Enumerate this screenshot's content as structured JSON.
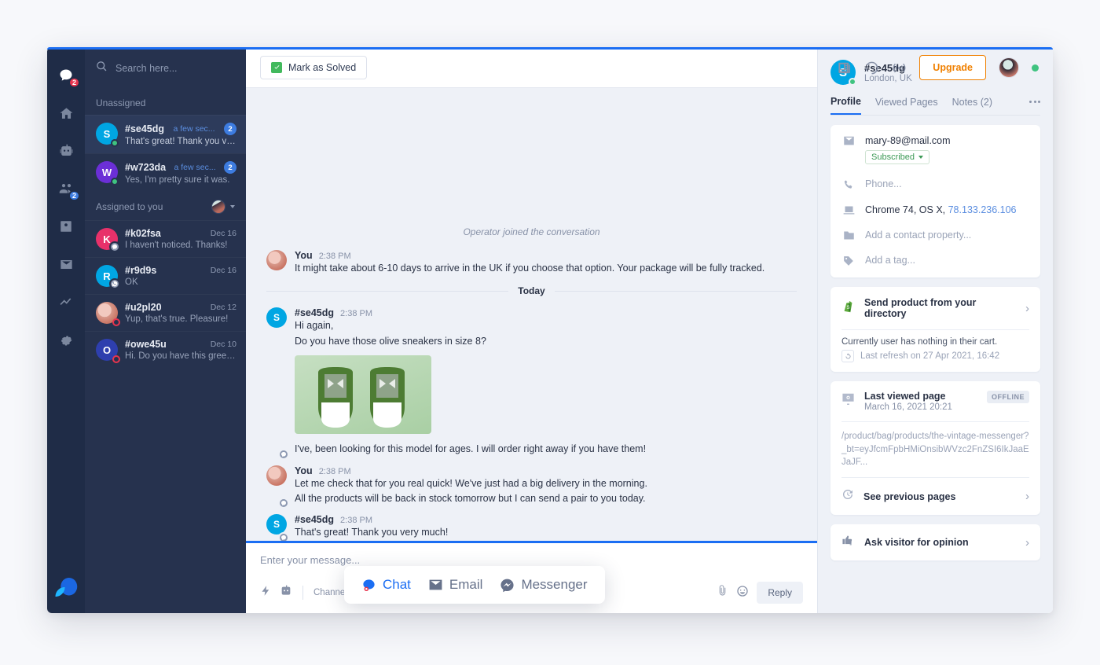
{
  "rail": {
    "items": [
      {
        "name": "chat",
        "icon": "chat-icon",
        "badge": "2",
        "badge_color": "red",
        "active": true
      },
      {
        "name": "home",
        "icon": "home-icon",
        "badge": "",
        "badge_color": "",
        "active": false
      },
      {
        "name": "bot",
        "icon": "robot-icon",
        "badge": "",
        "badge_color": "",
        "active": false
      },
      {
        "name": "visitors",
        "icon": "people-icon",
        "badge": "2",
        "badge_color": "blue",
        "active": false
      },
      {
        "name": "contacts",
        "icon": "contact-card-icon",
        "badge": "",
        "badge_color": "",
        "active": false
      },
      {
        "name": "mail",
        "icon": "envelope-icon",
        "badge": "",
        "badge_color": "",
        "active": false
      },
      {
        "name": "reports",
        "icon": "trend-line-icon",
        "badge": "",
        "badge_color": "",
        "active": false
      },
      {
        "name": "settings",
        "icon": "gear-icon",
        "badge": "",
        "badge_color": "",
        "active": false
      }
    ]
  },
  "search": {
    "placeholder": "Search here...",
    "value": ""
  },
  "conversations": {
    "groups": [
      {
        "title": "Unassigned",
        "has_assignee": false,
        "items": [
          {
            "name": "#se45dg",
            "preview": "That's great! Thank you very much!",
            "time": "a few sec...",
            "time_fresh": true,
            "count": "2",
            "initial": "S",
            "color": "#00a6e3",
            "presence": "online",
            "channel_icon": "",
            "selected": true
          },
          {
            "name": "#w723da",
            "preview": "Yes, I'm pretty sure it was.",
            "time": "a few sec...",
            "time_fresh": true,
            "count": "2",
            "initial": "W",
            "color": "#6b2fd6",
            "presence": "online",
            "channel_icon": "",
            "selected": false
          }
        ]
      },
      {
        "title": "Assigned to you",
        "has_assignee": true,
        "items": [
          {
            "name": "#k02fsa",
            "preview": "I haven't noticed. Thanks!",
            "time": "Dec 16",
            "time_fresh": false,
            "count": "",
            "initial": "K",
            "color": "#e8316a",
            "presence": "none",
            "channel_icon": "messenger",
            "selected": false
          },
          {
            "name": "#r9d9s",
            "preview": "OK",
            "time": "Dec 16",
            "time_fresh": false,
            "count": "",
            "initial": "R",
            "color": "#00a6e3",
            "presence": "none",
            "channel_icon": "whatsapp",
            "selected": false
          },
          {
            "name": "#u2pl20",
            "preview": "Yup, that's true. Pleasure!",
            "time": "Dec 12",
            "time_fresh": false,
            "count": "",
            "initial": "",
            "color": "photo",
            "presence": "none",
            "channel_icon": "ring",
            "selected": false
          },
          {
            "name": "#owe45u",
            "preview": "Hi. Do you have this green t-shirt?",
            "time": "Dec 10",
            "time_fresh": false,
            "count": "",
            "initial": "O",
            "color": "#2e3fae",
            "presence": "none",
            "channel_icon": "ring",
            "selected": false
          }
        ]
      }
    ]
  },
  "header": {
    "solve_label": "Mark as Solved",
    "upgrade_label": "Upgrade",
    "icons": [
      "news-icon",
      "loading-circle-icon",
      "broadcast-icon"
    ]
  },
  "chat": {
    "system_line": "Operator joined the conversation",
    "today_label": "Today",
    "messages": [
      {
        "author": "You",
        "time": "2:38 PM",
        "avatar": "photo",
        "initial": "",
        "color": "photo",
        "channel_icon": "",
        "lines": [
          "It might take about 6-10 days to arrive in the UK if you choose that option. Your package will be fully tracked."
        ],
        "image": false
      },
      {
        "author": "#se45dg",
        "time": "2:38 PM",
        "avatar": "initial",
        "initial": "S",
        "color": "#00a6e3",
        "channel_icon": "messenger",
        "lines": [
          "Hi again,",
          "Do you have those olive sneakers in size 8?"
        ],
        "image": true,
        "after_image": "I've, been looking for this model for ages. I will order right away if you have them!"
      },
      {
        "author": "You",
        "time": "2:38 PM",
        "avatar": "photo",
        "initial": "",
        "color": "photo",
        "channel_icon": "messenger",
        "lines": [
          "Let me check that for you real quick! We've just had a big delivery in the morning.",
          "All the products will be back in stock tomorrow but I can send a pair to you today."
        ],
        "image": false
      },
      {
        "author": "#se45dg",
        "time": "2:38 PM",
        "avatar": "initial",
        "initial": "S",
        "color": "#00a6e3",
        "channel_icon": "messenger",
        "lines": [
          "That's great! Thank you very much!"
        ],
        "image": false
      }
    ]
  },
  "composer": {
    "placeholder": "Enter your message...",
    "channel_label": "Channel:",
    "reply_label": "Reply",
    "channels": [
      {
        "label": "Chat",
        "icon": "chat-bubble-icon",
        "active": true
      },
      {
        "label": "Email",
        "icon": "envelope-icon",
        "active": false
      },
      {
        "label": "Messenger",
        "icon": "messenger-icon",
        "active": false
      }
    ]
  },
  "profile": {
    "name": "#se45dg",
    "location": "London, UK",
    "initial": "S",
    "color": "#00a6e3",
    "tabs": [
      {
        "label": "Profile",
        "active": true
      },
      {
        "label": "Viewed Pages",
        "active": false
      },
      {
        "label": "Notes (2)",
        "active": false
      }
    ],
    "fields": [
      {
        "icon": "envelope-icon",
        "value": "mary-89@mail.com",
        "muted": false,
        "badge": "Subscribed"
      },
      {
        "icon": "phone-icon",
        "value": "Phone...",
        "muted": true,
        "badge": ""
      },
      {
        "icon": "laptop-icon",
        "value": "Chrome 74, OS X,",
        "ip": "78.133.236.106",
        "muted": false,
        "badge": ""
      },
      {
        "icon": "folder-icon",
        "value": "Add a contact property...",
        "muted": true,
        "badge": ""
      },
      {
        "icon": "tag-icon",
        "value": "Add a tag...",
        "muted": true,
        "badge": ""
      }
    ],
    "product_card": {
      "title": "Send product from your directory",
      "icon": "shopify-icon",
      "cart_note": "Currently user has nothing in their cart.",
      "refresh_text": "Last refresh on 27 Apr 2021, 16:42"
    },
    "last_page_card": {
      "title": "Last viewed page",
      "date": "March 16, 2021 20:21",
      "status": "OFFLINE",
      "url": "/product/bag/products/the-vintage-messenger?_bt=eyJfcmFpbHMiOnsibWVzc2FnZSI6IkJaaEJaJF...",
      "see_previous": "See previous pages",
      "icon": "monitor-eye-icon"
    },
    "opinion_card": {
      "title": "Ask visitor for opinion",
      "icon": "thumbs-icon"
    }
  }
}
